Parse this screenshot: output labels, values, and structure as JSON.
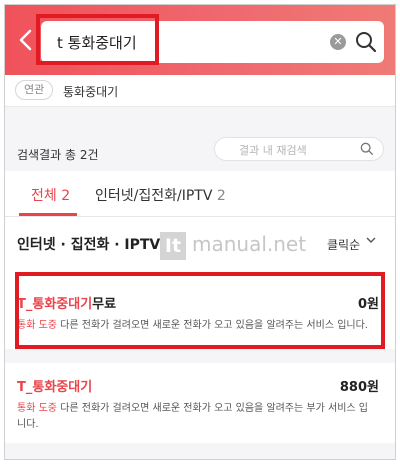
{
  "header": {
    "search_value": "t 통화중대기",
    "back_icon": "chevron-left-icon",
    "clear_icon": "clear-icon",
    "search_icon": "search-icon"
  },
  "related": {
    "chip_label": "연관",
    "term": "통화중대기"
  },
  "results": {
    "count_text": "검색결과 총 2건",
    "inner_search_placeholder": "결과 내 재검색"
  },
  "tabs": [
    {
      "label": "전체",
      "count": "2"
    },
    {
      "label": "인터넷/집전화/IPTV",
      "count": "2"
    }
  ],
  "section": {
    "title": "인터넷 · 집전화 · IPTV 2",
    "sort_label": "클릭순",
    "watermark_logo": "It",
    "watermark_text": "manual.net"
  },
  "items": [
    {
      "title_hl": "T_통화중대기",
      "title_rest": "무료",
      "price": "0원",
      "desc_hl1": "통화",
      "desc_hl2": "도중",
      "desc_rest": "다른 전화가 걸려오면 새로운 전화가 오고 있음을 알려주는 서비스 입니다."
    },
    {
      "title_hl": "T_통화중대기",
      "title_rest": "",
      "price": "880원",
      "desc_hl1": "통화",
      "desc_hl2": "도중",
      "desc_rest": "다른 전화가 걸려오면 새로운 전화가 오고 있음을 알려주는 부가 서비스 입니다."
    }
  ],
  "colors": {
    "accent": "#e9444b",
    "annotation_red": "#e11b22",
    "header_start": "#f0525b"
  }
}
